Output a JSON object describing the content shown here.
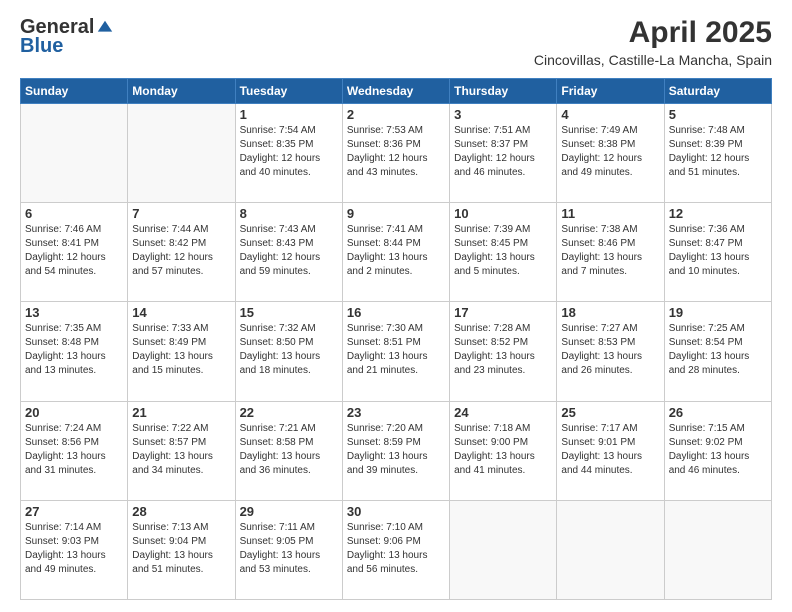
{
  "logo": {
    "general": "General",
    "blue": "Blue"
  },
  "title": "April 2025",
  "subtitle": "Cincovillas, Castille-La Mancha, Spain",
  "days_header": [
    "Sunday",
    "Monday",
    "Tuesday",
    "Wednesday",
    "Thursday",
    "Friday",
    "Saturday"
  ],
  "weeks": [
    [
      {
        "num": "",
        "info": ""
      },
      {
        "num": "",
        "info": ""
      },
      {
        "num": "1",
        "info": "Sunrise: 7:54 AM\nSunset: 8:35 PM\nDaylight: 12 hours and 40 minutes."
      },
      {
        "num": "2",
        "info": "Sunrise: 7:53 AM\nSunset: 8:36 PM\nDaylight: 12 hours and 43 minutes."
      },
      {
        "num": "3",
        "info": "Sunrise: 7:51 AM\nSunset: 8:37 PM\nDaylight: 12 hours and 46 minutes."
      },
      {
        "num": "4",
        "info": "Sunrise: 7:49 AM\nSunset: 8:38 PM\nDaylight: 12 hours and 49 minutes."
      },
      {
        "num": "5",
        "info": "Sunrise: 7:48 AM\nSunset: 8:39 PM\nDaylight: 12 hours and 51 minutes."
      }
    ],
    [
      {
        "num": "6",
        "info": "Sunrise: 7:46 AM\nSunset: 8:41 PM\nDaylight: 12 hours and 54 minutes."
      },
      {
        "num": "7",
        "info": "Sunrise: 7:44 AM\nSunset: 8:42 PM\nDaylight: 12 hours and 57 minutes."
      },
      {
        "num": "8",
        "info": "Sunrise: 7:43 AM\nSunset: 8:43 PM\nDaylight: 12 hours and 59 minutes."
      },
      {
        "num": "9",
        "info": "Sunrise: 7:41 AM\nSunset: 8:44 PM\nDaylight: 13 hours and 2 minutes."
      },
      {
        "num": "10",
        "info": "Sunrise: 7:39 AM\nSunset: 8:45 PM\nDaylight: 13 hours and 5 minutes."
      },
      {
        "num": "11",
        "info": "Sunrise: 7:38 AM\nSunset: 8:46 PM\nDaylight: 13 hours and 7 minutes."
      },
      {
        "num": "12",
        "info": "Sunrise: 7:36 AM\nSunset: 8:47 PM\nDaylight: 13 hours and 10 minutes."
      }
    ],
    [
      {
        "num": "13",
        "info": "Sunrise: 7:35 AM\nSunset: 8:48 PM\nDaylight: 13 hours and 13 minutes."
      },
      {
        "num": "14",
        "info": "Sunrise: 7:33 AM\nSunset: 8:49 PM\nDaylight: 13 hours and 15 minutes."
      },
      {
        "num": "15",
        "info": "Sunrise: 7:32 AM\nSunset: 8:50 PM\nDaylight: 13 hours and 18 minutes."
      },
      {
        "num": "16",
        "info": "Sunrise: 7:30 AM\nSunset: 8:51 PM\nDaylight: 13 hours and 21 minutes."
      },
      {
        "num": "17",
        "info": "Sunrise: 7:28 AM\nSunset: 8:52 PM\nDaylight: 13 hours and 23 minutes."
      },
      {
        "num": "18",
        "info": "Sunrise: 7:27 AM\nSunset: 8:53 PM\nDaylight: 13 hours and 26 minutes."
      },
      {
        "num": "19",
        "info": "Sunrise: 7:25 AM\nSunset: 8:54 PM\nDaylight: 13 hours and 28 minutes."
      }
    ],
    [
      {
        "num": "20",
        "info": "Sunrise: 7:24 AM\nSunset: 8:56 PM\nDaylight: 13 hours and 31 minutes."
      },
      {
        "num": "21",
        "info": "Sunrise: 7:22 AM\nSunset: 8:57 PM\nDaylight: 13 hours and 34 minutes."
      },
      {
        "num": "22",
        "info": "Sunrise: 7:21 AM\nSunset: 8:58 PM\nDaylight: 13 hours and 36 minutes."
      },
      {
        "num": "23",
        "info": "Sunrise: 7:20 AM\nSunset: 8:59 PM\nDaylight: 13 hours and 39 minutes."
      },
      {
        "num": "24",
        "info": "Sunrise: 7:18 AM\nSunset: 9:00 PM\nDaylight: 13 hours and 41 minutes."
      },
      {
        "num": "25",
        "info": "Sunrise: 7:17 AM\nSunset: 9:01 PM\nDaylight: 13 hours and 44 minutes."
      },
      {
        "num": "26",
        "info": "Sunrise: 7:15 AM\nSunset: 9:02 PM\nDaylight: 13 hours and 46 minutes."
      }
    ],
    [
      {
        "num": "27",
        "info": "Sunrise: 7:14 AM\nSunset: 9:03 PM\nDaylight: 13 hours and 49 minutes."
      },
      {
        "num": "28",
        "info": "Sunrise: 7:13 AM\nSunset: 9:04 PM\nDaylight: 13 hours and 51 minutes."
      },
      {
        "num": "29",
        "info": "Sunrise: 7:11 AM\nSunset: 9:05 PM\nDaylight: 13 hours and 53 minutes."
      },
      {
        "num": "30",
        "info": "Sunrise: 7:10 AM\nSunset: 9:06 PM\nDaylight: 13 hours and 56 minutes."
      },
      {
        "num": "",
        "info": ""
      },
      {
        "num": "",
        "info": ""
      },
      {
        "num": "",
        "info": ""
      }
    ]
  ]
}
